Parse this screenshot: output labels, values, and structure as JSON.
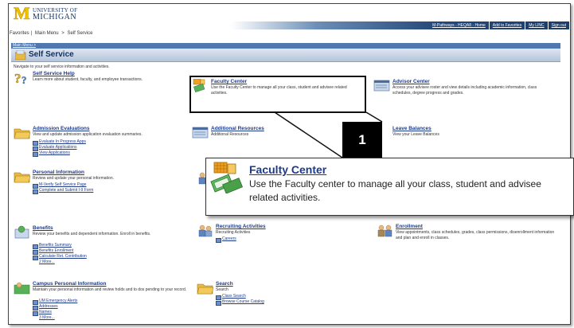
{
  "header": {
    "logo_line1": "UNIVERSITY OF",
    "logo_line2": "MICHIGAN",
    "links": [
      "M-Pathways - HEQA8 - Home",
      "Add to Favorites",
      "My LINC",
      "Sign out"
    ]
  },
  "breadcrumb": [
    "Favorites",
    "Main Menu",
    ">",
    "Self Service"
  ],
  "section": {
    "menu_link": "Main Menu >",
    "title": "Self Service",
    "subtitle": "Navigate to your self service information and activities."
  },
  "tiles": {
    "self_service_help": {
      "title": "Self Service Help",
      "desc": "Learn more about student, faculty, and employee transactions."
    },
    "faculty_center": {
      "title": "Faculty Center",
      "desc": "Use the Faculty Center to manage all your class, student and advisee related activities."
    },
    "advisor_center": {
      "title": "Advisor Center",
      "desc": "Access your advisee roster and view details including academic information, class schedules, degree progress and grades."
    },
    "admission_evaluations": {
      "title": "Admission Evaluations",
      "desc": "View and update admission application evaluation summaries.",
      "links": [
        "Evaluate In Progress Apps",
        "Evaluate Applications",
        "View Applications"
      ]
    },
    "additional_resources": {
      "title": "Additional Resources",
      "desc": "Additional Resources"
    },
    "leave_balances": {
      "title": "Leave Balances",
      "desc": "View your Leave Balances"
    },
    "personal_information": {
      "title": "Personal Information",
      "desc": "Review and update your personal information.",
      "links": [
        "M-Verify Self Service Page",
        "Complete and Submit I-9 Form"
      ]
    },
    "benefits": {
      "title": "Benefits",
      "desc": "Review your benefits and dependent information. Enroll in benefits.",
      "links": [
        "Benefits Summary",
        "Benefits Enrollment",
        "Calculate Ret. Contribution"
      ],
      "more": "2 More..."
    },
    "recruiting_activities": {
      "title": "Recruiting Activities",
      "desc": "Recruiting Activities",
      "links": [
        "Careers"
      ]
    },
    "enrollment": {
      "title": "Enrollment",
      "desc": "View appointments, class schedules, grades, class permissions, disenrollment information and plan and enroll in classes."
    },
    "campus_personal_information": {
      "title": "Campus Personal Information",
      "desc": "Maintain your personal information and review holds and to dos pending to your record.",
      "links": [
        "UM Emergency Alerts",
        "Addresses",
        "Names"
      ],
      "more": "3 More..."
    },
    "search": {
      "title": "Search",
      "desc": "Search",
      "links": [
        "Class Search",
        "Browse Course Catalog"
      ]
    }
  },
  "callout": {
    "badge": "1",
    "title": "Faculty Center",
    "desc": "Use the Faculty center to manage all your class, student and advisee related activities."
  }
}
